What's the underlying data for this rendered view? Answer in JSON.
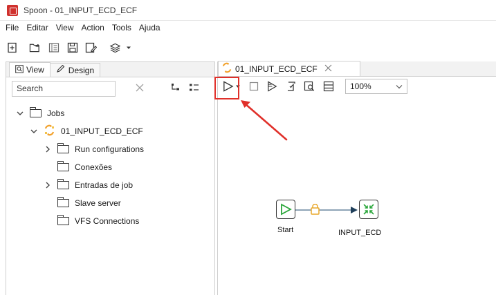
{
  "window": {
    "title": "Spoon - 01_INPUT_ECD_ECF"
  },
  "menu": [
    "File",
    "Editar",
    "View",
    "Action",
    "Tools",
    "Ajuda"
  ],
  "left_panel": {
    "tabs": [
      {
        "label": "View",
        "icon": "search-icon"
      },
      {
        "label": "Design",
        "icon": "pencil-icon"
      }
    ],
    "search": {
      "value": "Search"
    },
    "tree": {
      "root": "Jobs",
      "job": "01_INPUT_ECD_ECF",
      "items": [
        {
          "label": "Run configurations",
          "expandable": true
        },
        {
          "label": "Conexões",
          "expandable": false
        },
        {
          "label": "Entradas de job",
          "expandable": true
        },
        {
          "label": "Slave server",
          "expandable": false
        },
        {
          "label": "VFS Connections",
          "expandable": false
        }
      ]
    }
  },
  "editor": {
    "tab_label": "01_INPUT_ECD_ECF",
    "zoom": "100%",
    "nodes": {
      "start": {
        "label": "Start"
      },
      "input": {
        "label": "INPUT_ECD"
      }
    }
  },
  "colors": {
    "accent_green": "#2aa63a",
    "highlight_red": "#e0302a",
    "job_orange": "#f2a12b",
    "lock_yellow": "#e9a82c"
  }
}
